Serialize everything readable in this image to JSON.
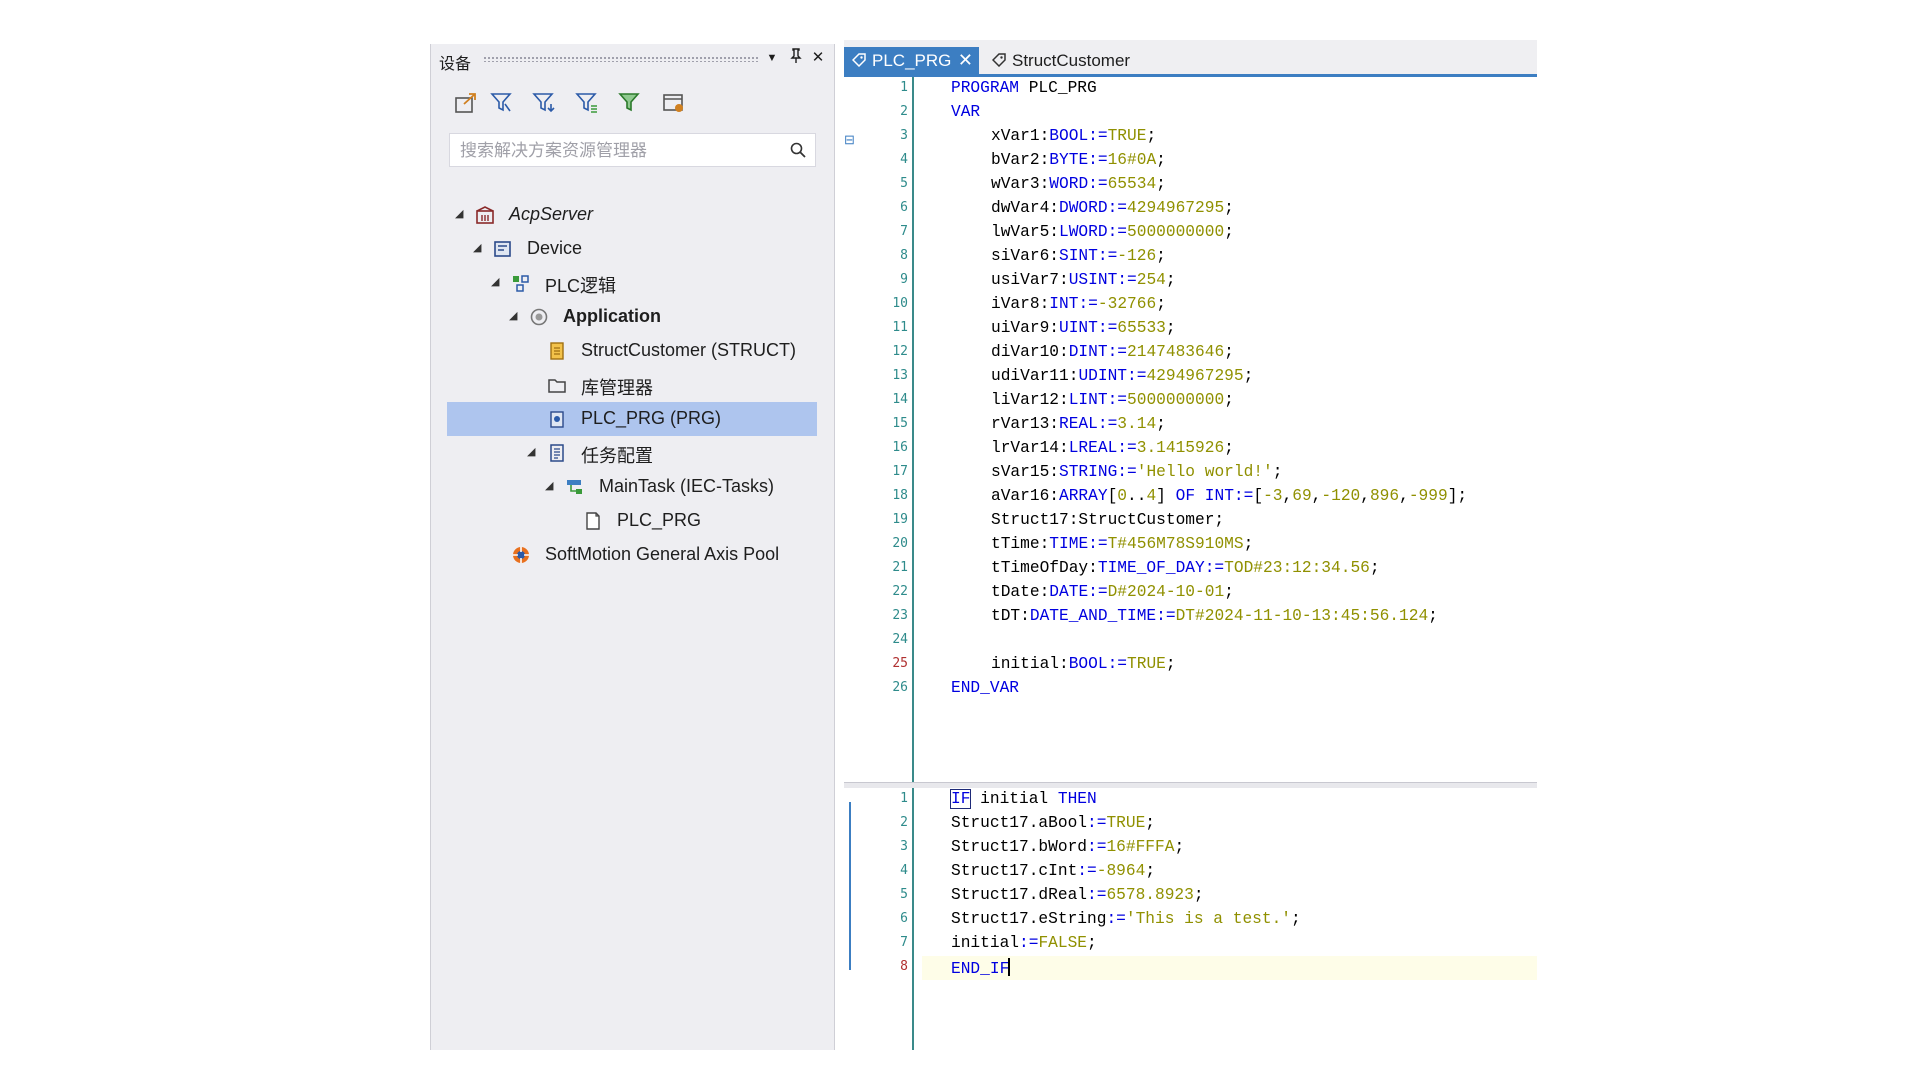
{
  "left_panel": {
    "title": "设备",
    "search_placeholder": "搜索解决方案资源管理器",
    "tree": [
      {
        "label": "AcpServer",
        "italic": true,
        "icon": "server-icon"
      },
      {
        "label": "Device",
        "icon": "device-icon"
      },
      {
        "label": "PLC逻辑",
        "icon": "plc-logic-icon"
      },
      {
        "label": "Application",
        "bold": true,
        "icon": "application-icon"
      },
      {
        "label": "StructCustomer (STRUCT)",
        "icon": "struct-icon"
      },
      {
        "label": "库管理器",
        "icon": "library-manager-icon"
      },
      {
        "label": "PLC_PRG (PRG)",
        "icon": "prg-icon",
        "selected": true
      },
      {
        "label": "任务配置",
        "icon": "task-config-icon"
      },
      {
        "label": "MainTask (IEC-Tasks)",
        "icon": "task-icon"
      },
      {
        "label": "PLC_PRG",
        "icon": "program-call-icon"
      },
      {
        "label": "SoftMotion General Axis Pool",
        "icon": "axis-pool-icon"
      }
    ]
  },
  "editor": {
    "tabs": [
      {
        "label": "PLC_PRG",
        "active": true
      },
      {
        "label": "StructCustomer",
        "active": false
      }
    ],
    "declaration_line_numbers": [
      "1",
      "2",
      "3",
      "4",
      "5",
      "6",
      "7",
      "8",
      "9",
      "10",
      "11",
      "12",
      "13",
      "14",
      "15",
      "16",
      "17",
      "18",
      "19",
      "20",
      "21",
      "22",
      "23",
      "24",
      "25",
      "26"
    ],
    "implementation_line_numbers": [
      "1",
      "2",
      "3",
      "4",
      "5",
      "6",
      "7",
      "8"
    ]
  },
  "colors": {
    "accent": "#3c7ec2",
    "selection": "#aec5ee",
    "keyword": "#0000e0",
    "literal": "#909000",
    "line_number": "#2e8b8b"
  }
}
